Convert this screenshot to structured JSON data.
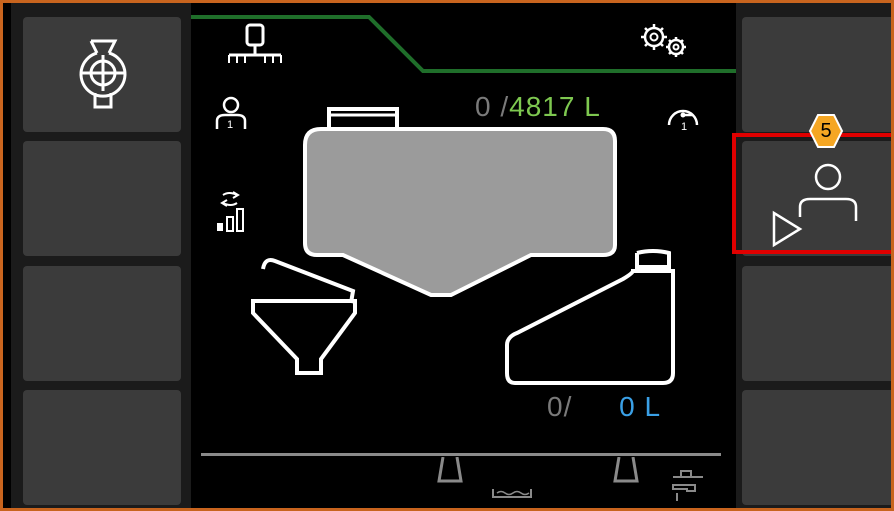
{
  "tank": {
    "main_actual": "0",
    "main_separator": "/",
    "main_capacity": "4817 L",
    "rinse_actual": "0",
    "rinse_separator": "/",
    "rinse_capacity": "0 L"
  },
  "user_badge": "1",
  "header_badge": "1",
  "callout": {
    "number": "5"
  },
  "colors": {
    "frame_border": "#c8641e",
    "tab_line": "#1f6e2a",
    "main_amount": "#7ec850",
    "rinse_amount": "#3aa0e6",
    "highlight": "#e00000",
    "callout_fill": "#f5a623"
  },
  "icons": {
    "top_left_softkey": "pump-icon",
    "tab_icon": "sprayer-boom-icon",
    "settings": "gears-icon",
    "user": "user-icon",
    "signal": "signal-strength-icon",
    "hopper": "hopper-icon",
    "rinse_tank": "rinse-tank-icon",
    "header_gauge": "gauge-icon",
    "right_softkey_2": "operator-start-icon",
    "drain": "drain-icon",
    "tap": "water-tap-icon"
  }
}
